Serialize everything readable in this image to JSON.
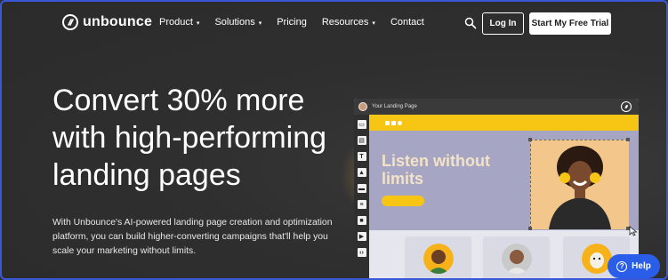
{
  "brand": {
    "name": "unbounce"
  },
  "nav": {
    "items": [
      {
        "label": "Product",
        "dropdown": true
      },
      {
        "label": "Solutions",
        "dropdown": true
      },
      {
        "label": "Pricing",
        "dropdown": false
      },
      {
        "label": "Resources",
        "dropdown": true
      },
      {
        "label": "Contact",
        "dropdown": false
      }
    ],
    "search_icon": "search-icon",
    "login_label": "Log In",
    "trial_label": "Start My Free Trial"
  },
  "hero": {
    "headline": "Convert 30% more with high-performing landing pages",
    "subtext": "With Unbounce's AI-powered landing page creation and optimization platform, you can build higher-converting campaigns that'll help you scale your marketing without limits."
  },
  "mockup": {
    "window_title": "Your Landing Page",
    "canvas_heading": "Listen without limits",
    "tools": [
      "layout-icon",
      "section-icon",
      "text-icon",
      "image-icon",
      "button-icon",
      "form-icon",
      "box-icon",
      "video-icon",
      "code-icon"
    ]
  },
  "help": {
    "label": "Help",
    "icon": "question-icon"
  },
  "colors": {
    "background": "#2f2f2f",
    "accent_yellow": "#f7c614",
    "canvas_purple": "#a7a5c4",
    "help_blue": "#2a5ee8",
    "frame_border": "#3b56d9"
  }
}
